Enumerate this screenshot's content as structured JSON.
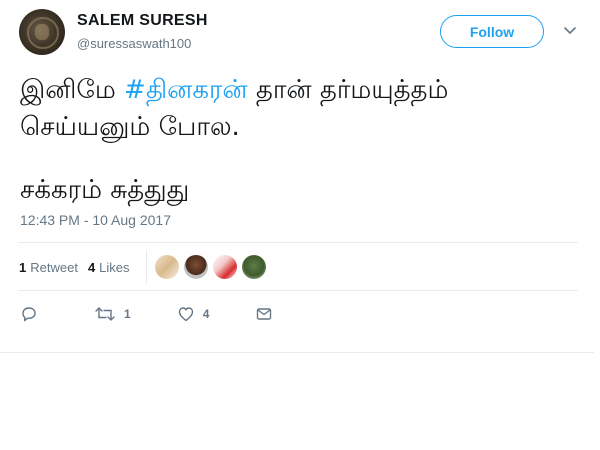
{
  "author": {
    "display_name": "SALEM SURESH",
    "handle": "@suressaswath100"
  },
  "follow_button": {
    "label": "Follow"
  },
  "tweet": {
    "line1_before": "இனிமே ",
    "hashtag": "#தினகரன்",
    "line1_after": " தான் தர்மயுத்தம்",
    "line2": "செய்யனும் போல.",
    "line3": "சக்கரம் சுத்துது"
  },
  "timestamp": "12:43 PM - 10 Aug 2017",
  "stats": {
    "retweet_count": "1",
    "retweet_label": "Retweet",
    "like_count": "4",
    "like_label": "Likes"
  },
  "actions": {
    "reply_icon": "reply-icon",
    "retweet_icon": "retweet-icon",
    "retweet_count": "1",
    "like_icon": "heart-icon",
    "like_count": "4",
    "message_icon": "envelope-icon"
  },
  "colors": {
    "accent": "#1da1f2",
    "text": "#14171a",
    "muted": "#657786",
    "divider": "#e6ecf0"
  }
}
